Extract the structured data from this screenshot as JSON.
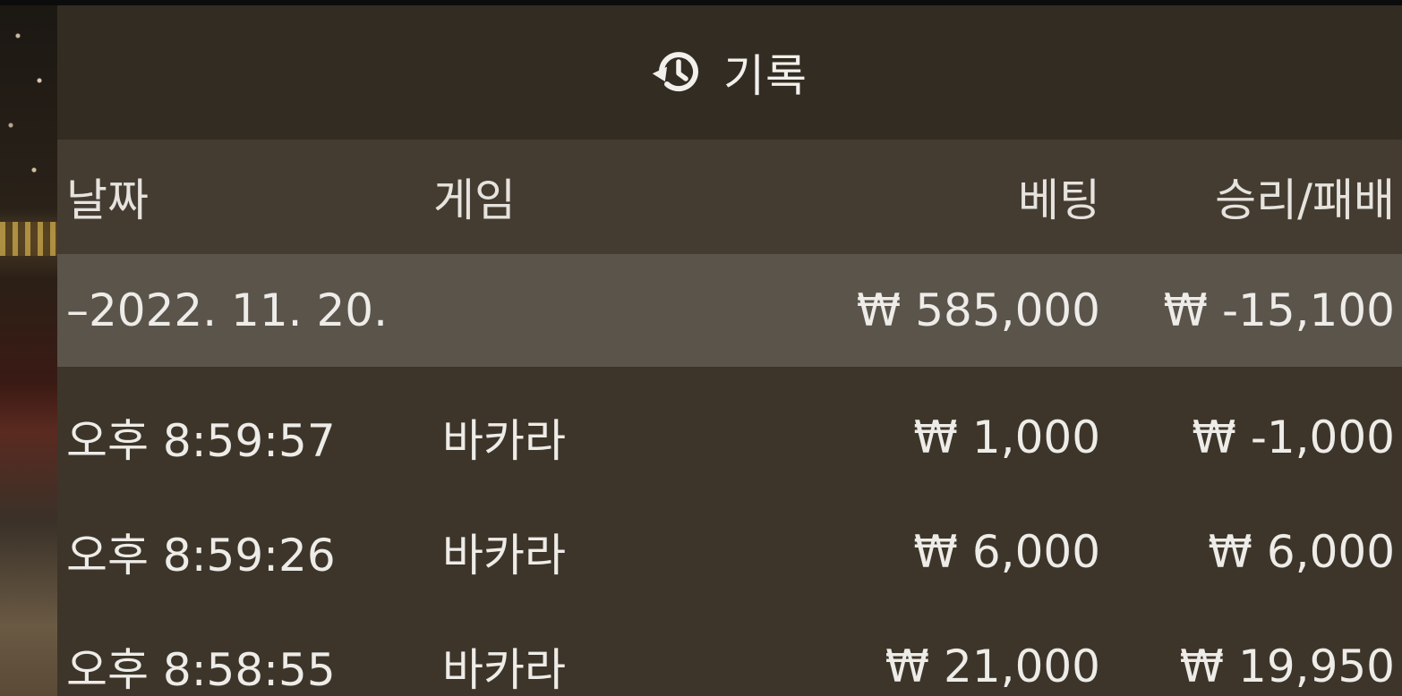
{
  "title": {
    "icon": "history-icon",
    "text": "기록"
  },
  "columns": {
    "date": "날짜",
    "game": "게임",
    "bet": "베팅",
    "result": "승리/패배"
  },
  "currency_symbol": "₩",
  "summary": {
    "date": "–2022. 11. 20.",
    "bet": "585,000",
    "result": "-15,100"
  },
  "rows": [
    {
      "time": "오후 8:59:57",
      "game": "바카라",
      "bet": "1,000",
      "result": "-1,000"
    },
    {
      "time": "오후 8:59:26",
      "game": "바카라",
      "bet": "6,000",
      "result": "6,000"
    },
    {
      "time": "오후 8:58:55",
      "game": "바카라",
      "bet": "21,000",
      "result": "19,950"
    }
  ],
  "colors": {
    "panel_bg": "#3d3529",
    "title_bg": "#332c22",
    "header_bg": "#443c31",
    "summary_bg": "#5b544b",
    "text": "#eeece8"
  }
}
